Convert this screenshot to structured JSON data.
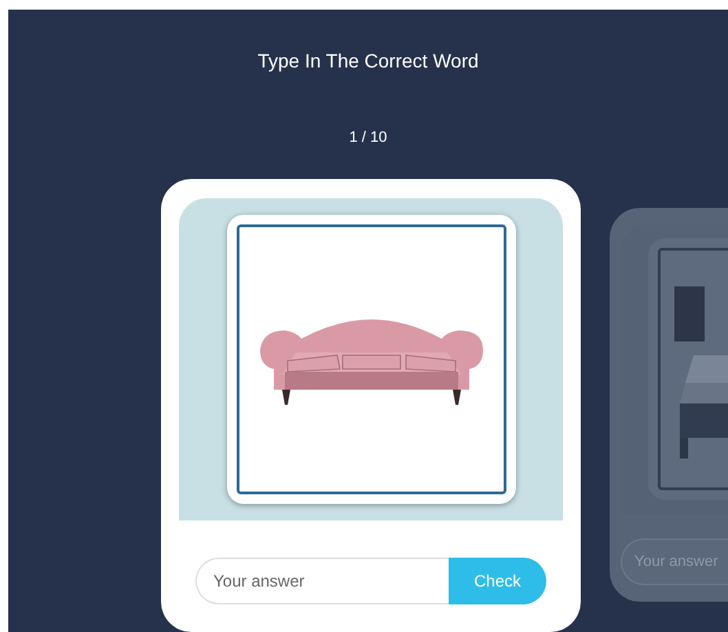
{
  "title": "Type In The Correct Word",
  "progress": "1 / 10",
  "cards": [
    {
      "selected": true,
      "placeholder": "Your answer",
      "button": "Check"
    },
    {
      "selected": false,
      "placeholder": "Your answer"
    }
  ]
}
